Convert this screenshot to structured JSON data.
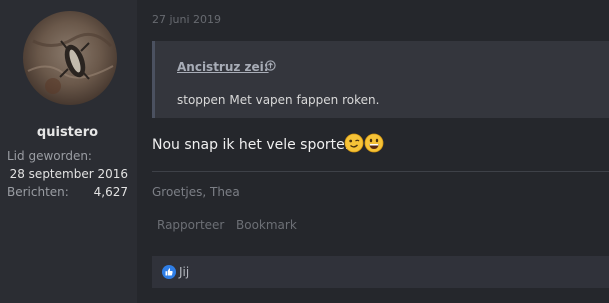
{
  "user": {
    "name": "quistero",
    "stats": [
      {
        "label": "Lid geworden:",
        "value": "28 september 2016"
      },
      {
        "label": "Berichten:",
        "value": "4,627"
      }
    ]
  },
  "post": {
    "date": "27 juni 2019",
    "quote": {
      "author": "Ancistruz zei:",
      "text": "stoppen Met vapen fappen roken."
    },
    "body": "Nou snap ik het vele sporten",
    "emojis": [
      "wink-face",
      "grinning-face"
    ],
    "signature": "Groetjes, Thea",
    "actions": {
      "report": "Rapporteer",
      "bookmark": "Bookmark"
    },
    "reactions": {
      "icon": "like-icon",
      "users": "Jij"
    }
  },
  "colors": {
    "background": "#2b2d33",
    "main_panel": "#25272c",
    "quote_bg": "#34363d",
    "like_blue": "#2f7ee6"
  }
}
